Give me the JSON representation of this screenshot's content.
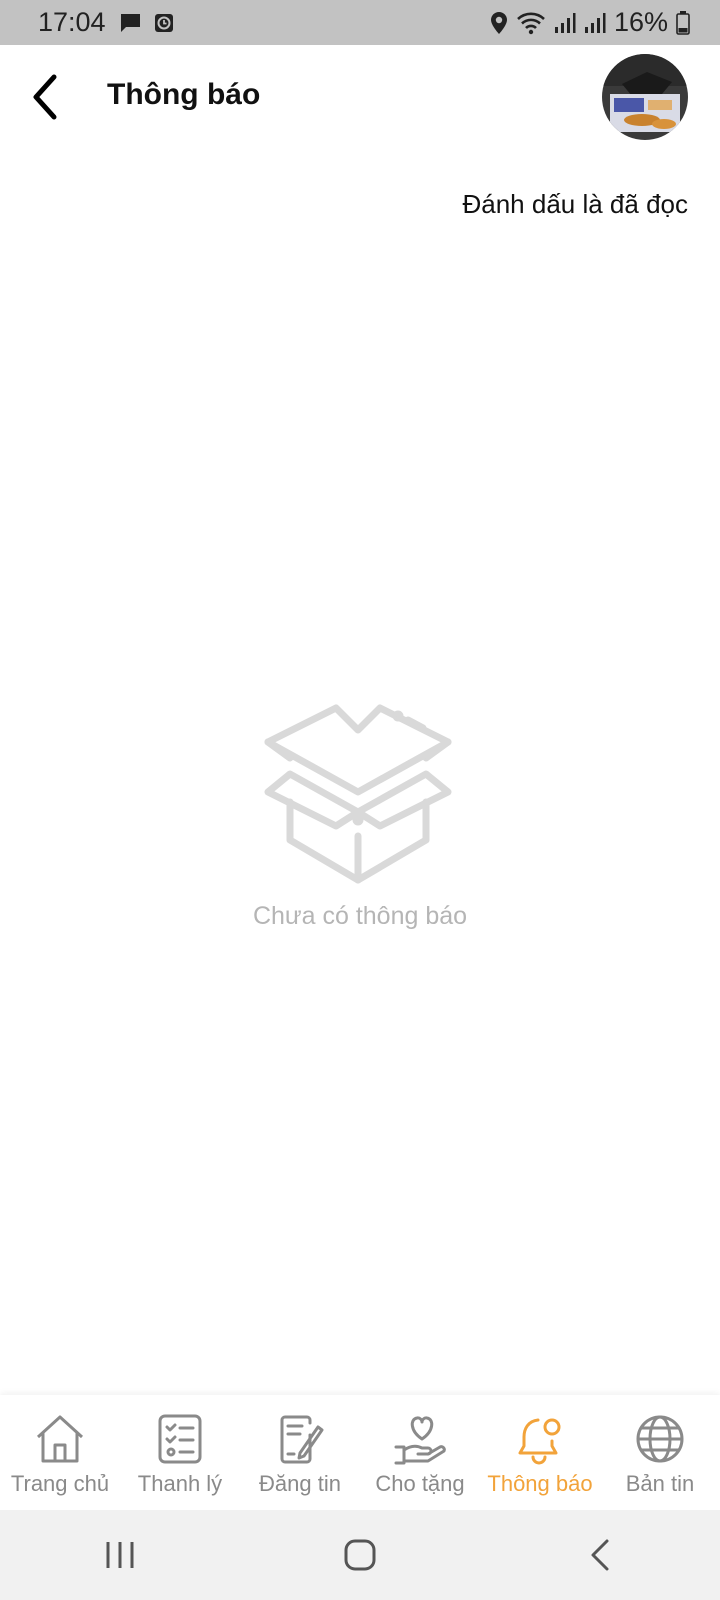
{
  "status_bar": {
    "time": "17:04",
    "battery_percent": "16%"
  },
  "header": {
    "title": "Thông báo"
  },
  "actions": {
    "mark_read_label": "Đánh dấu là đã đọc"
  },
  "empty_state": {
    "message": "Chưa có thông báo",
    "icon": "open-box-icon"
  },
  "bottom_nav": {
    "active": "Thông báo",
    "active_color": "#f2a33a",
    "inactive_color": "#8a8a8a",
    "items": [
      {
        "label": "Trang chủ",
        "icon": "home-icon"
      },
      {
        "label": "Thanh lý",
        "icon": "checklist-icon"
      },
      {
        "label": "Đăng tin",
        "icon": "edit-document-icon"
      },
      {
        "label": "Cho tặng",
        "icon": "heart-hand-icon"
      },
      {
        "label": "Thông báo",
        "icon": "bell-icon"
      },
      {
        "label": "Bản tin",
        "icon": "globe-icon"
      }
    ]
  }
}
